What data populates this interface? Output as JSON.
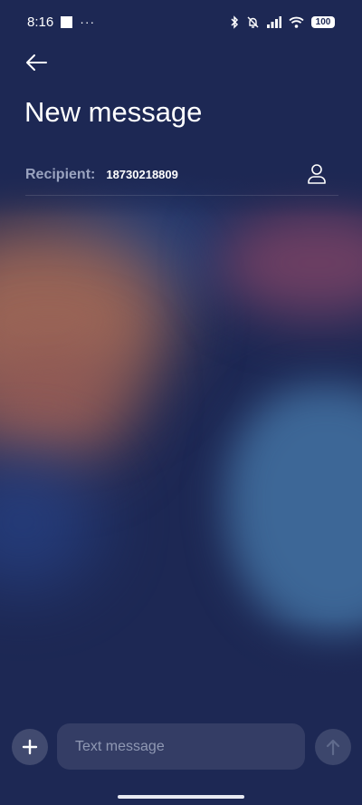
{
  "status_bar": {
    "time": "8:16",
    "overflow": "···",
    "battery": "100",
    "icons": [
      "notification-square-icon",
      "bluetooth-icon",
      "silent-bell-icon",
      "signal-icon",
      "wifi-icon",
      "battery-icon"
    ]
  },
  "header": {
    "back_icon": "back-arrow-icon",
    "title": "New message"
  },
  "recipient": {
    "label": "Recipient:",
    "value": "18730218809",
    "contact_icon": "person-icon"
  },
  "composer": {
    "add_icon": "plus-icon",
    "placeholder": "Text message",
    "send_icon": "send-arrow-up-icon"
  },
  "colors": {
    "background": "#1d2854",
    "label_gray": "#9aa3bf",
    "accent_orange": "#9a6556",
    "accent_blue": "#3d6797"
  }
}
